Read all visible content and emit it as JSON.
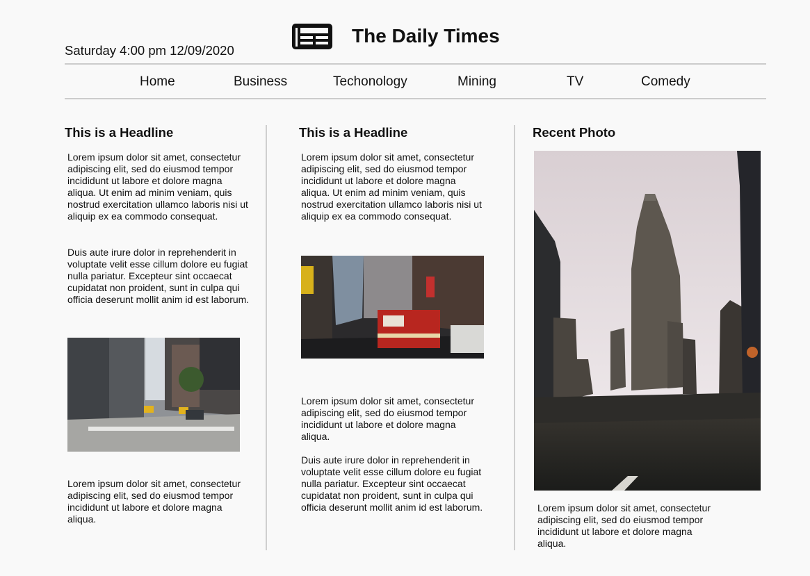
{
  "header": {
    "datetime": "Saturday 4:00 pm 12/09/2020",
    "site_title": "The Daily Times",
    "logo_icon": "newspaper-icon"
  },
  "nav": {
    "items": [
      "Home",
      "Business",
      "Techonology",
      "Mining",
      "TV",
      "Comedy"
    ]
  },
  "columns": {
    "left": {
      "headline": "This is a Headline",
      "p1": "Lorem ipsum dolor sit amet, consectetur adipiscing elit, sed do eiusmod tempor incididunt ut labore et dolore magna aliqua. Ut enim ad minim veniam, quis nostrud exercitation ullamco laboris nisi ut aliquip ex ea commodo consequat.",
      "p2": "Duis aute irure dolor in reprehenderit in voluptate velit esse cillum dolore eu fugiat nulla pariatur. Excepteur sint occaecat cupidatat non proident, sunt in culpa qui officia deserunt mollit anim id est laborum.",
      "p3": "Lorem ipsum dolor sit amet, consectetur adipiscing elit, sed do eiusmod tempor incididunt ut labore et dolore magna aliqua."
    },
    "middle": {
      "headline": "This is a Headline",
      "p1": "Lorem ipsum dolor sit amet, consectetur adipiscing elit, sed do eiusmod tempor incididunt ut labore et dolore magna aliqua. Ut enim ad minim veniam, quis nostrud exercitation ullamco laboris nisi ut aliquip ex ea commodo consequat.",
      "p2": "Lorem ipsum dolor sit amet, consectetur adipiscing elit, sed do eiusmod tempor incididunt ut labore et dolore magna aliqua.",
      "p3": "Duis aute irure dolor in reprehenderit in voluptate velit esse cillum dolore eu fugiat nulla pariatur. Excepteur sint occaecat cupidatat non proident, sunt in culpa qui officia deserunt mollit anim id est laborum."
    },
    "right": {
      "headline": "Recent Photo",
      "caption": "Lorem ipsum dolor sit amet, consectetur adipiscing elit, sed do eiusmod tempor incididunt ut labore et dolore magna aliqua."
    }
  }
}
